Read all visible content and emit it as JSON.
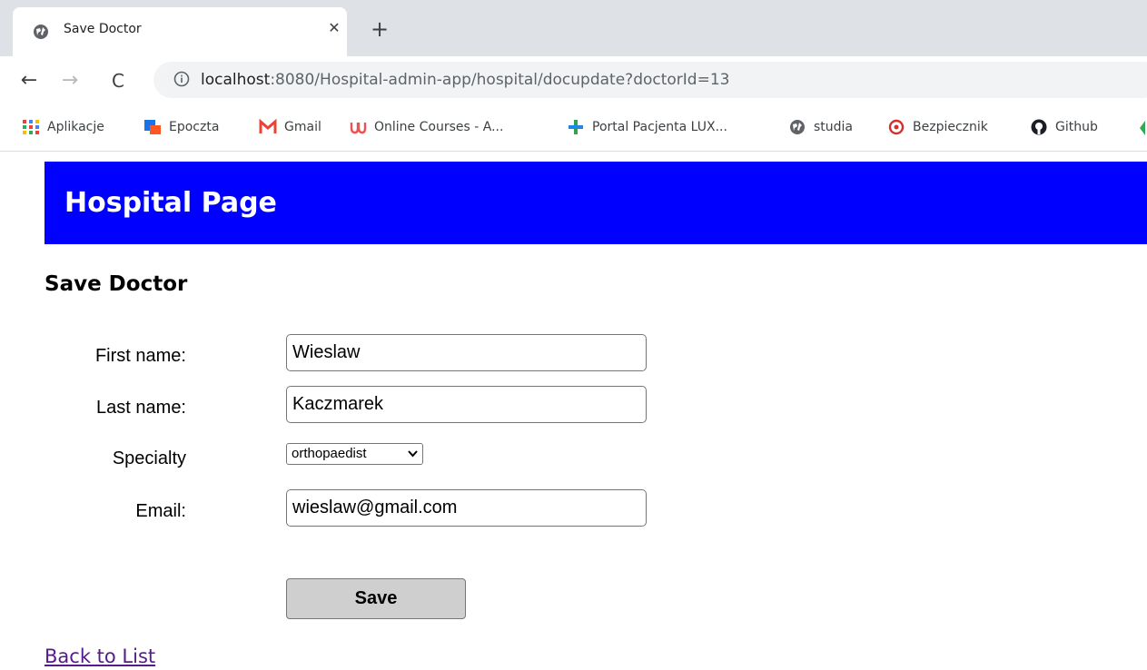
{
  "browser": {
    "tab": {
      "title": "Save Doctor",
      "favicon": "globe-icon",
      "close_symbol": "✕"
    },
    "new_tab_symbol": "+",
    "nav": {
      "back_symbol": "←",
      "forward_symbol": "→",
      "reload_symbol": "C"
    },
    "url": {
      "host": "localhost",
      "rest": ":8080/Hospital-admin-app/hospital/docupdate?doctorId=13"
    },
    "bookmarks": [
      {
        "label": "Aplikacje",
        "icon": "apps-grid-icon"
      },
      {
        "label": "Epoczta",
        "icon": "epoczta-icon"
      },
      {
        "label": "Gmail",
        "icon": "gmail-icon"
      },
      {
        "label": "Online Courses - A...",
        "icon": "udemy-icon"
      },
      {
        "label": "Portal Pacjenta LUX...",
        "icon": "luxmed-icon"
      },
      {
        "label": "studia",
        "icon": "globe-icon"
      },
      {
        "label": "Bezpiecznik",
        "icon": "bezpiecznik-icon"
      },
      {
        "label": "Github",
        "icon": "github-icon"
      }
    ]
  },
  "page": {
    "banner_title": "Hospital Page",
    "heading": "Save Doctor",
    "form": {
      "first_name_label": "First name:",
      "first_name_value": "Wieslaw",
      "last_name_label": "Last name:",
      "last_name_value": "Kaczmarek",
      "specialty_label": "Specialty",
      "specialty_value": "orthopaedist",
      "email_label": "Email:",
      "email_value": "wieslaw@gmail.com",
      "save_label": "Save"
    },
    "back_link": "Back to List"
  },
  "colors": {
    "banner": "#0000ff",
    "link": "#551a8b",
    "button": "#cfcfcf"
  }
}
